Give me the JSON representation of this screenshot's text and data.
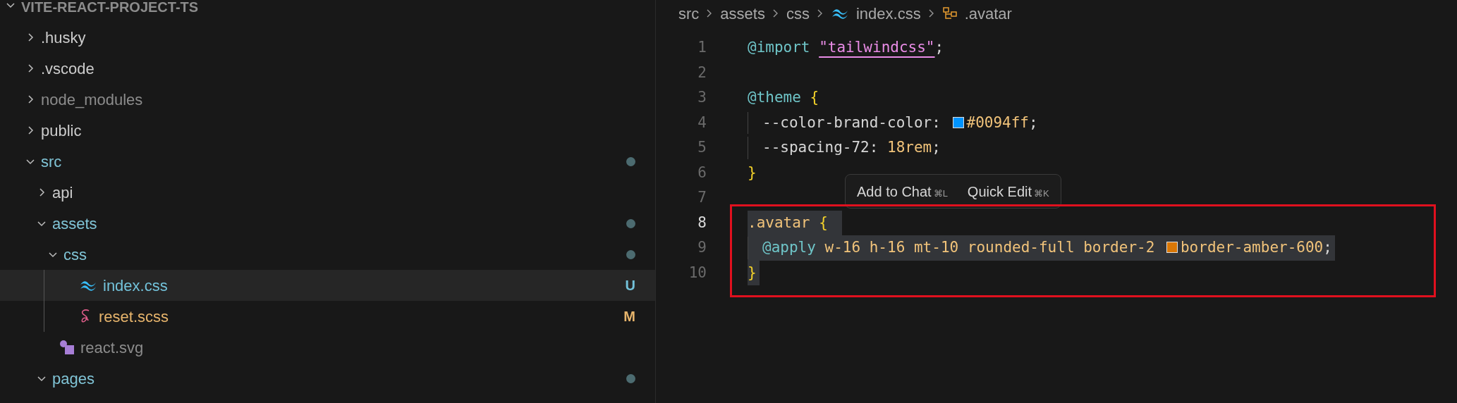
{
  "explorer": {
    "title": "VITE-REACT-PROJECT-TS",
    "items": [
      {
        "name": ".husky",
        "kind": "folder",
        "expanded": false,
        "selected": false,
        "color": "#cccccc",
        "change_dot": false
      },
      {
        "name": ".vscode",
        "kind": "folder",
        "expanded": false,
        "selected": false,
        "color": "#cccccc",
        "change_dot": false
      },
      {
        "name": "node_modules",
        "kind": "folder",
        "expanded": false,
        "selected": false,
        "color": "#8c8c8c",
        "change_dot": false
      },
      {
        "name": "public",
        "kind": "folder",
        "expanded": false,
        "selected": false,
        "color": "#cccccc",
        "change_dot": false
      },
      {
        "name": "src",
        "kind": "folder",
        "expanded": true,
        "selected": false,
        "color": "#80c4d6",
        "change_dot": true,
        "children": [
          {
            "name": "api",
            "kind": "folder",
            "expanded": false,
            "selected": false,
            "color": "#cccccc",
            "change_dot": false
          },
          {
            "name": "assets",
            "kind": "folder",
            "expanded": true,
            "selected": false,
            "color": "#80c4d6",
            "change_dot": true,
            "children": [
              {
                "name": "css",
                "kind": "folder",
                "expanded": true,
                "selected": false,
                "color": "#80c4d6",
                "change_dot": true,
                "children": [
                  {
                    "name": "index.css",
                    "kind": "tailwind",
                    "selected": true,
                    "color": "#73c2da",
                    "badge": "U"
                  },
                  {
                    "name": "reset.scss",
                    "kind": "sass",
                    "selected": false,
                    "color": "#e6b46c",
                    "badge": "M"
                  }
                ]
              },
              {
                "name": "react.svg",
                "kind": "svg",
                "selected": false,
                "color": "#8c8c8c"
              }
            ]
          },
          {
            "name": "pages",
            "kind": "folder",
            "expanded": true,
            "selected": false,
            "color": "#80c4d6",
            "change_dot": true
          }
        ]
      }
    ]
  },
  "breadcrumb": [
    {
      "kind": "folder",
      "text": "src"
    },
    {
      "kind": "folder",
      "text": "assets"
    },
    {
      "kind": "folder",
      "text": "css"
    },
    {
      "kind": "tailwind",
      "text": "index.css"
    },
    {
      "kind": "symbol",
      "text": ".avatar"
    }
  ],
  "editor": {
    "lines": [
      {
        "number": "1",
        "current": false,
        "selected": false,
        "tokens": [
          {
            "kind": "keyword",
            "text": "@import "
          },
          {
            "kind": "string",
            "text": "\"tailwindcss\""
          },
          {
            "kind": "punct",
            "text": ";"
          }
        ]
      },
      {
        "number": "2",
        "current": false,
        "selected": false
      },
      {
        "number": "3",
        "current": false,
        "selected": false,
        "tokens": [
          {
            "kind": "keyword",
            "text": "@theme "
          },
          {
            "kind": "brace",
            "text": "{"
          }
        ]
      },
      {
        "number": "4",
        "current": false,
        "selected": false,
        "indented": true,
        "tokens": [
          {
            "kind": "punct",
            "text": "--color-brand-color: "
          },
          {
            "kind": "swatch",
            "color": "#0094ff"
          },
          {
            "kind": "value",
            "text": "#0094ff"
          },
          {
            "kind": "punct",
            "text": ";"
          }
        ]
      },
      {
        "number": "5",
        "current": false,
        "selected": false,
        "indented": true,
        "tokens": [
          {
            "kind": "punct",
            "text": "--spacing-72: "
          },
          {
            "kind": "value",
            "text": "18rem"
          },
          {
            "kind": "punct",
            "text": ";"
          }
        ]
      },
      {
        "number": "6",
        "current": false,
        "selected": false,
        "tokens": [
          {
            "kind": "brace",
            "text": "}"
          }
        ]
      },
      {
        "number": "7",
        "current": false,
        "selected": false
      },
      {
        "number": "8",
        "current": true,
        "selected": true,
        "tokens": [
          {
            "kind": "value",
            "text": ".avatar "
          },
          {
            "kind": "brace",
            "text": "{"
          }
        ]
      },
      {
        "number": "9",
        "current": false,
        "selected": true,
        "indented": true,
        "tokens": [
          {
            "kind": "keyword",
            "text": "@apply "
          },
          {
            "kind": "value",
            "text": "w-16 h-16 mt-10 rounded-full border-2 "
          },
          {
            "kind": "swatch",
            "color": "#d97706"
          },
          {
            "kind": "value",
            "text": "border-amber-600"
          },
          {
            "kind": "punct",
            "text": ";"
          }
        ]
      },
      {
        "number": "10",
        "current": false,
        "selected": true,
        "tokens": [
          {
            "kind": "brace",
            "text": "}"
          }
        ]
      }
    ]
  },
  "popup": {
    "actions": [
      {
        "label": "Add to Chat",
        "shortcut": "⌘L"
      },
      {
        "label": "Quick Edit",
        "shortcut": "⌘K"
      }
    ]
  },
  "highlight_box": {
    "color": "#e0101e"
  }
}
